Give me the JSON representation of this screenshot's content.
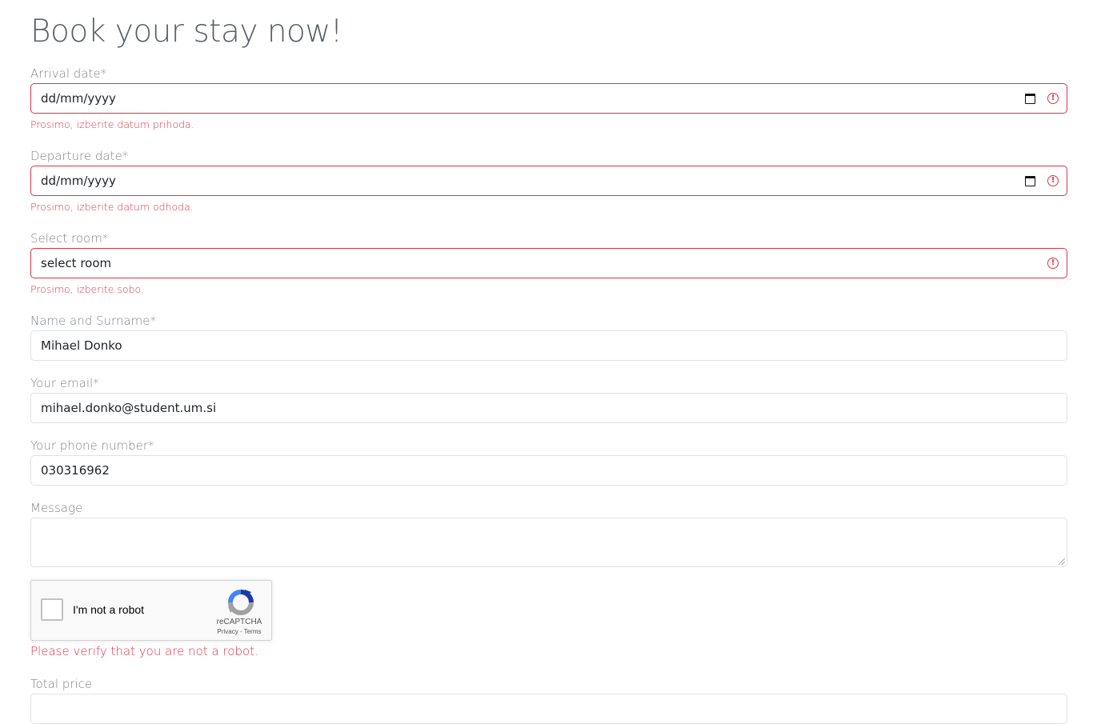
{
  "page": {
    "title": "Book your stay now!"
  },
  "form": {
    "arrival": {
      "label": "Arrival date*",
      "value": "dd/mm/yyyy",
      "error": "Prosimo, izberite datum prihoda."
    },
    "departure": {
      "label": "Departure date*",
      "value": "dd/mm/yyyy",
      "error": "Prosimo, izberite datum odhoda."
    },
    "room": {
      "label": "Select room*",
      "value": "select room",
      "error": "Prosimo, izberite sobo."
    },
    "name": {
      "label": "Name and Surname*",
      "value": "Mihael Donko"
    },
    "email": {
      "label": "Your email*",
      "value": "mihael.donko@student.um.si"
    },
    "phone": {
      "label": "Your phone number*",
      "value": "030316962"
    },
    "message": {
      "label": "Message",
      "value": ""
    },
    "total": {
      "label": "Total price",
      "value": ""
    }
  },
  "recaptcha": {
    "checkbox_label": "I'm not a robot",
    "brand": "reCAPTCHA",
    "links": "Privacy - Terms",
    "error": "Please verify that you are not a robot."
  },
  "colors": {
    "error": "#dc3545",
    "border": "#dee2e6",
    "label": "#808487"
  },
  "icons": [
    "calendar-icon",
    "error-icon",
    "recaptcha-logo-icon",
    "resize-handle-icon"
  ]
}
